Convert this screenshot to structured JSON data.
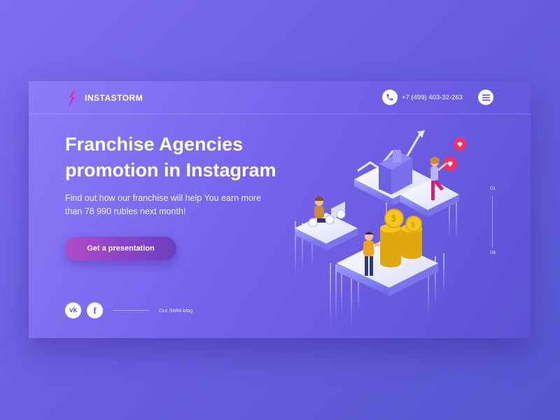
{
  "brand": {
    "name": "INSTASTORM"
  },
  "header": {
    "phone": "+7 (499) 403-32-263"
  },
  "hero": {
    "title": "Franchise Agencies promotion in Instagram",
    "subtitle": "Find out how our franchise will help You earn more than 78 990 rubles next month!",
    "cta_label": "Get a presentation"
  },
  "footer": {
    "blog_label": "Our SMM blog"
  },
  "slider": {
    "current": "01",
    "total": "08"
  },
  "icons": {
    "logo": "lightning-bolt-icon",
    "phone": "phone-icon",
    "menu": "hamburger-menu-icon",
    "vk": "vk-icon",
    "facebook": "facebook-icon"
  },
  "colors": {
    "background": "#6a5fe0",
    "card": "#7663ec",
    "cta_start": "#b04cc6",
    "cta_end": "#6b3fbe",
    "accent": "#ff2a5f",
    "coin": "#f6c71a"
  }
}
